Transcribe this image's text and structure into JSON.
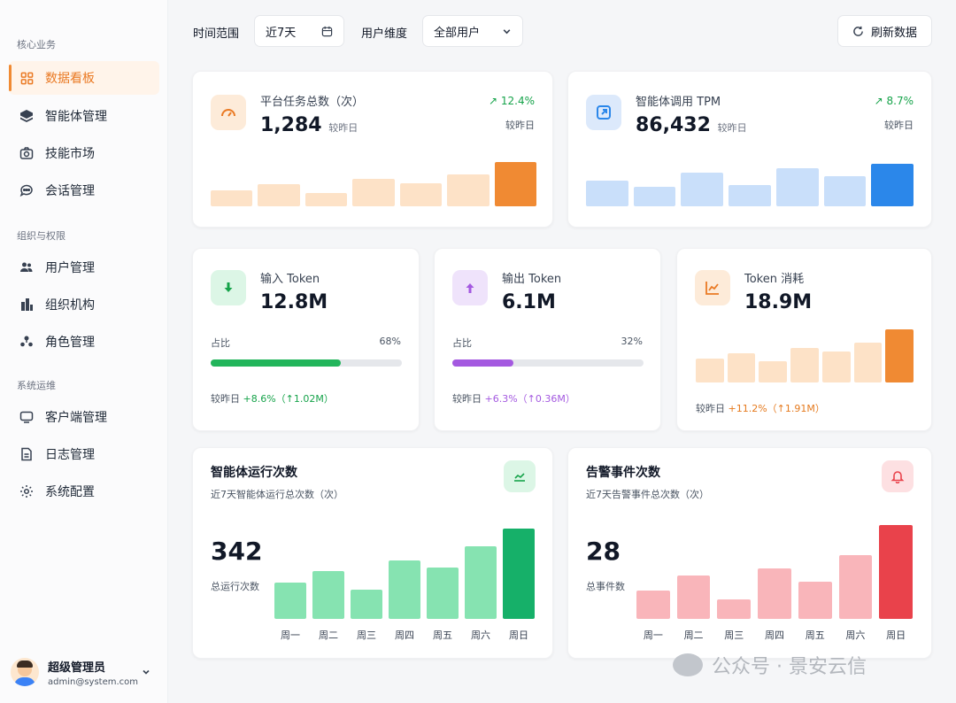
{
  "sidebar": {
    "sections": [
      {
        "title": "核心业务",
        "items": [
          {
            "label": "数据看板",
            "icon": "dashboard-icon",
            "active": true
          },
          {
            "label": "智能体管理",
            "icon": "agent-icon"
          },
          {
            "label": "技能市场",
            "icon": "camera-icon"
          },
          {
            "label": "会话管理",
            "icon": "chat-icon"
          }
        ]
      },
      {
        "title": "组织与权限",
        "items": [
          {
            "label": "用户管理",
            "icon": "users-icon"
          },
          {
            "label": "组织机构",
            "icon": "building-icon"
          },
          {
            "label": "角色管理",
            "icon": "roles-icon"
          }
        ]
      },
      {
        "title": "系统运维",
        "items": [
          {
            "label": "客户端管理",
            "icon": "client-icon"
          },
          {
            "label": "日志管理",
            "icon": "log-icon"
          },
          {
            "label": "系统配置",
            "icon": "gear-icon"
          }
        ]
      }
    ],
    "user": {
      "name": "超级管理员",
      "email": "admin@system.com"
    }
  },
  "toolbar": {
    "time_range_label": "时间范围",
    "time_range_value": "近7天",
    "user_dim_label": "用户维度",
    "user_dim_value": "全部用户",
    "refresh_label": "刷新数据"
  },
  "colors": {
    "orange": "#f08a33",
    "blue": "#2b87ea",
    "green": "#16a34a",
    "purple": "#a459e0",
    "red": "#e9424b"
  },
  "cards": {
    "tasks": {
      "label": "平台任务总数（次）",
      "value": "1,284",
      "sub": "较昨日",
      "trend": "12.4%",
      "trend_sub": "较昨日",
      "bars": [
        0.35,
        0.5,
        0.3,
        0.62,
        0.52,
        0.72,
        1.0
      ]
    },
    "tpm": {
      "label": "智能体调用 TPM",
      "value": "86,432",
      "sub": "较昨日",
      "trend": "8.7%",
      "trend_sub": "较昨日",
      "bars": [
        0.6,
        0.45,
        0.8,
        0.5,
        0.9,
        0.7,
        1.0
      ]
    },
    "input": {
      "label": "输入 Token",
      "value": "12.8M",
      "ratio_label": "占比",
      "ratio_text": "68%",
      "ratio": 0.68,
      "cmp_label": "较昨日",
      "cmp": "+8.6%（↑1.02M）"
    },
    "output": {
      "label": "输出 Token",
      "value": "6.1M",
      "ratio_label": "占比",
      "ratio_text": "32%",
      "ratio": 0.32,
      "cmp_label": "较昨日",
      "cmp": "+6.3%（↑0.36M）"
    },
    "consume": {
      "label": "Token 消耗",
      "value": "18.9M",
      "cmp_label": "较昨日",
      "cmp": "+11.2%（↑1.91M）",
      "bars": [
        0.45,
        0.55,
        0.4,
        0.65,
        0.58,
        0.75,
        1.0
      ]
    },
    "runs": {
      "title": "智能体运行次数",
      "sub": "近7天智能体运行总次数（次）",
      "value": "342",
      "value_label": "总运行次数",
      "days": [
        "周一",
        "周二",
        "周三",
        "周四",
        "周五",
        "周六",
        "周日"
      ],
      "bars": [
        0.4,
        0.53,
        0.32,
        0.65,
        0.57,
        0.8,
        1.0
      ]
    },
    "alerts": {
      "title": "告警事件次数",
      "sub": "近7天告警事件总次数（次）",
      "value": "28",
      "value_label": "总事件数",
      "days": [
        "周一",
        "周二",
        "周三",
        "周四",
        "周五",
        "周六",
        "周日"
      ],
      "bars": [
        0.3,
        0.46,
        0.21,
        0.54,
        0.4,
        0.68,
        1.0
      ]
    }
  },
  "watermark": "公众号 · 景安云信"
}
